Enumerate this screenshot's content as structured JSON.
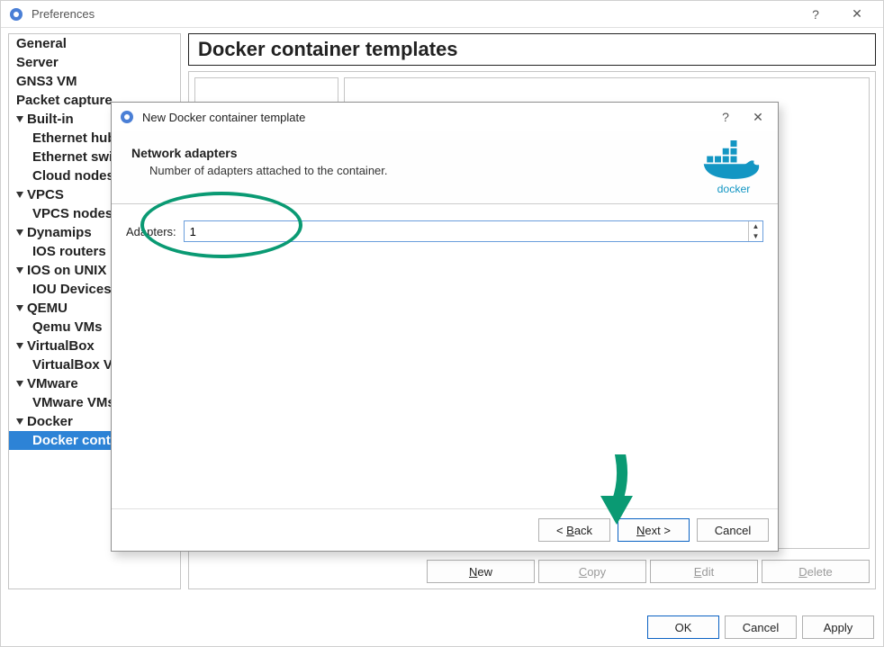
{
  "prefs": {
    "title": "Preferences",
    "help_icon": "?",
    "close_icon": "✕",
    "sidebar": [
      {
        "label": "General",
        "expandable": false,
        "child": false
      },
      {
        "label": "Server",
        "expandable": false,
        "child": false
      },
      {
        "label": "GNS3 VM",
        "expandable": false,
        "child": false
      },
      {
        "label": "Packet capture",
        "expandable": false,
        "child": false
      },
      {
        "label": "Built-in",
        "expandable": true,
        "child": false
      },
      {
        "label": "Ethernet hubs",
        "expandable": false,
        "child": true
      },
      {
        "label": "Ethernet switches",
        "expandable": false,
        "child": true
      },
      {
        "label": "Cloud nodes",
        "expandable": false,
        "child": true
      },
      {
        "label": "VPCS",
        "expandable": true,
        "child": false
      },
      {
        "label": "VPCS nodes",
        "expandable": false,
        "child": true
      },
      {
        "label": "Dynamips",
        "expandable": true,
        "child": false
      },
      {
        "label": "IOS routers",
        "expandable": false,
        "child": true
      },
      {
        "label": "IOS on UNIX",
        "expandable": true,
        "child": false
      },
      {
        "label": "IOU Devices",
        "expandable": false,
        "child": true
      },
      {
        "label": "QEMU",
        "expandable": true,
        "child": false
      },
      {
        "label": "Qemu VMs",
        "expandable": false,
        "child": true
      },
      {
        "label": "VirtualBox",
        "expandable": true,
        "child": false
      },
      {
        "label": "VirtualBox VMs",
        "expandable": false,
        "child": true
      },
      {
        "label": "VMware",
        "expandable": true,
        "child": false
      },
      {
        "label": "VMware VMs",
        "expandable": false,
        "child": true
      },
      {
        "label": "Docker",
        "expandable": true,
        "child": false
      },
      {
        "label": "Docker containers",
        "expandable": false,
        "child": true,
        "selected": true
      }
    ],
    "main_title": "Docker container templates",
    "template_buttons": {
      "new": "New",
      "copy": "Copy",
      "edit": "Edit",
      "delete": "Delete"
    },
    "footer": {
      "ok": "OK",
      "cancel": "Cancel",
      "apply": "Apply"
    }
  },
  "dialog": {
    "title": "New Docker container template",
    "help_icon": "?",
    "close_icon": "✕",
    "header_title": "Network adapters",
    "header_subtitle": "Number of adapters attached to the container.",
    "logo_text": "docker",
    "adapter_label": "Adapters:",
    "adapter_value": "1",
    "buttons": {
      "back": "< Back",
      "next": "Next >",
      "cancel": "Cancel"
    }
  }
}
